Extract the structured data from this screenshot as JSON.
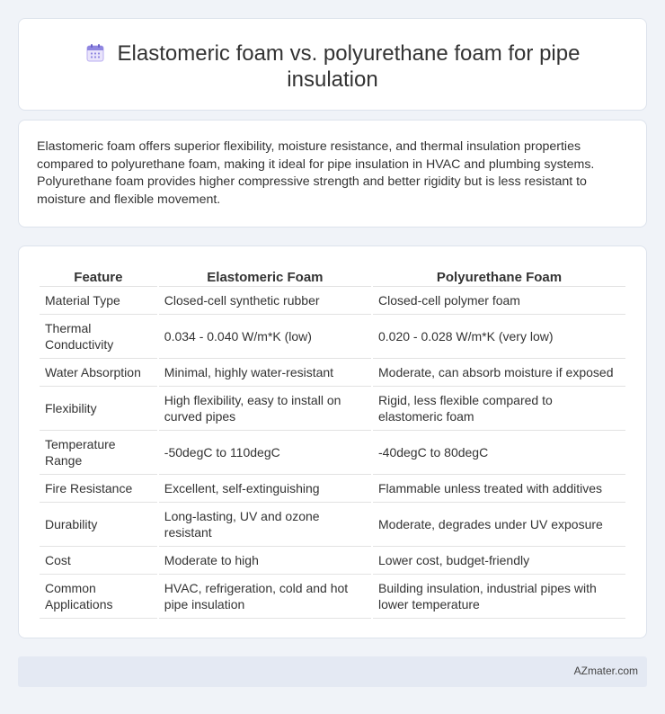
{
  "header": {
    "title_line1": "Elastomeric foam vs. polyurethane foam for pipe",
    "title_line2": "insulation",
    "icon": "calendar-icon"
  },
  "summary": {
    "text": "Elastomeric foam offers superior flexibility, moisture resistance, and thermal insulation properties compared to polyurethane foam, making it ideal for pipe insulation in HVAC and plumbing systems. Polyurethane foam provides higher compressive strength and better rigidity but is less resistant to moisture and flexible movement."
  },
  "table": {
    "headers": [
      "Feature",
      "Elastomeric Foam",
      "Polyurethane Foam"
    ],
    "rows": [
      {
        "feature": "Material Type",
        "elastomeric": "Closed-cell synthetic rubber",
        "polyurethane": "Closed-cell polymer foam"
      },
      {
        "feature": "Thermal Conductivity",
        "elastomeric": "0.034 - 0.040 W/m*K (low)",
        "polyurethane": "0.020 - 0.028 W/m*K (very low)"
      },
      {
        "feature": "Water Absorption",
        "elastomeric": "Minimal, highly water-resistant",
        "polyurethane": "Moderate, can absorb moisture if exposed"
      },
      {
        "feature": "Flexibility",
        "elastomeric": "High flexibility, easy to install on curved pipes",
        "polyurethane": "Rigid, less flexible compared to elastomeric foam"
      },
      {
        "feature": "Temperature Range",
        "elastomeric": "-50degC to 110degC",
        "polyurethane": "-40degC to 80degC"
      },
      {
        "feature": "Fire Resistance",
        "elastomeric": "Excellent, self-extinguishing",
        "polyurethane": "Flammable unless treated with additives"
      },
      {
        "feature": "Durability",
        "elastomeric": "Long-lasting, UV and ozone resistant",
        "polyurethane": "Moderate, degrades under UV exposure"
      },
      {
        "feature": "Cost",
        "elastomeric": "Moderate to high",
        "polyurethane": "Lower cost, budget-friendly"
      },
      {
        "feature": "Common Applications",
        "elastomeric": "HVAC, refrigeration, cold and hot pipe insulation",
        "polyurethane": "Building insulation, industrial pipes with lower temperature"
      }
    ]
  },
  "footer": {
    "site": "AZmater.com"
  }
}
